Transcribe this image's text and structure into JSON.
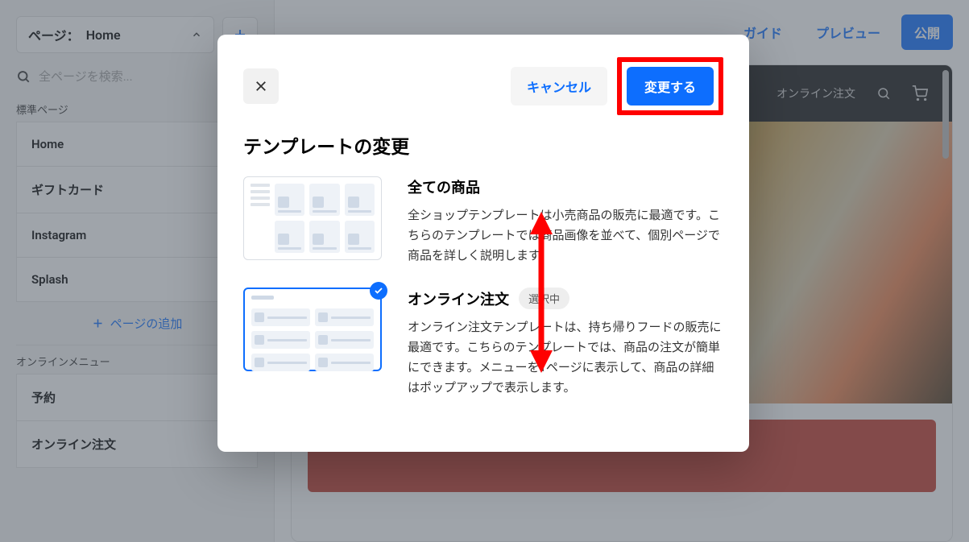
{
  "sidebar": {
    "page_label_prefix": "ページ：",
    "current_page": "Home",
    "search_placeholder": "全ページを検索...",
    "section_standard": "標準ページ",
    "items_standard": [
      {
        "label": "Home"
      },
      {
        "label": "ギフトカード"
      },
      {
        "label": "Instagram"
      },
      {
        "label": "Splash"
      }
    ],
    "add_page": "ページの追加",
    "section_online": "オンラインメニュー",
    "items_online": [
      {
        "label": "予約"
      },
      {
        "label": "オンライン注文"
      }
    ]
  },
  "topbar": {
    "guide": "ガイド",
    "preview": "プレビュー",
    "publish": "公開"
  },
  "site_header": {
    "nav_item": "オンライン注文"
  },
  "modal": {
    "cancel": "キャンセル",
    "apply": "変更する",
    "title": "テンプレートの変更",
    "options": [
      {
        "title": "全ての商品",
        "desc": "全ショップテンプレートは小売商品の販売に最適です。こちらのテンプレートでは商品画像を並べて、個別ページで商品を詳しく説明します。"
      },
      {
        "title": "オンライン注文",
        "badge": "選択中",
        "desc": "オンライン注文テンプレートは、持ち帰りフードの販売に最適です。こちらのテンプレートでは、商品の注文が簡単にできます。メニューを1ページに表示して、商品の詳細はポップアップで表示します。"
      }
    ]
  },
  "icons": {
    "search": "search-icon",
    "plus": "plus-icon",
    "chevron": "chevron-down-icon",
    "close": "close-icon",
    "check": "check-icon",
    "cart": "cart-icon"
  }
}
